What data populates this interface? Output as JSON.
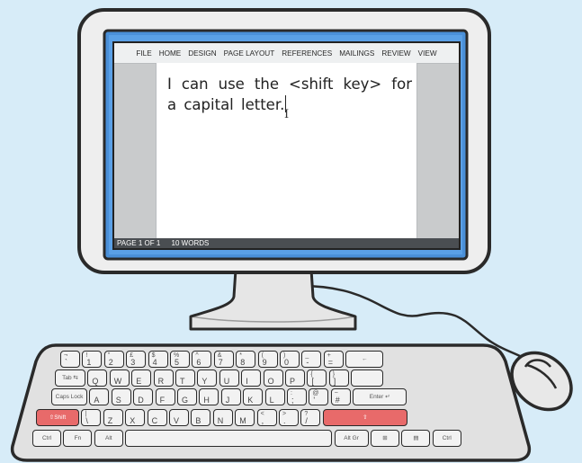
{
  "ribbon": {
    "tabs": [
      "FILE",
      "HOME",
      "DESIGN",
      "PAGE LAYOUT",
      "REFERENCES",
      "MAILINGS",
      "REVIEW",
      "VIEW"
    ]
  },
  "document": {
    "text": "I can use the <shift key> for a capital letter."
  },
  "status_bar": {
    "page": "PAGE 1 OF 1",
    "words": "10 WORDS"
  },
  "keyboard": {
    "rows": [
      [
        {
          "top": "¬",
          "bot": "`"
        },
        {
          "top": "!",
          "bot": "1"
        },
        {
          "top": "\"",
          "bot": "2"
        },
        {
          "top": "£",
          "bot": "3"
        },
        {
          "top": "$",
          "bot": "4"
        },
        {
          "top": "%",
          "bot": "5"
        },
        {
          "top": "^",
          "bot": "6"
        },
        {
          "top": "&",
          "bot": "7"
        },
        {
          "top": "*",
          "bot": "8"
        },
        {
          "top": "(",
          "bot": "9"
        },
        {
          "top": ")",
          "bot": "0"
        },
        {
          "top": "_",
          "bot": "-"
        },
        {
          "top": "+",
          "bot": "="
        },
        {
          "mid": "←"
        }
      ],
      [
        {
          "mid": "Tab ⇆"
        },
        {
          "bot": "Q"
        },
        {
          "bot": "W"
        },
        {
          "bot": "E"
        },
        {
          "bot": "R"
        },
        {
          "bot": "T"
        },
        {
          "bot": "Y"
        },
        {
          "bot": "U"
        },
        {
          "bot": "I"
        },
        {
          "bot": "O"
        },
        {
          "bot": "P"
        },
        {
          "top": "{",
          "bot": "["
        },
        {
          "top": "}",
          "bot": "]"
        },
        {
          "mid": ""
        }
      ],
      [
        {
          "mid": "Caps Lock"
        },
        {
          "bot": "A"
        },
        {
          "bot": "S"
        },
        {
          "bot": "D"
        },
        {
          "bot": "F"
        },
        {
          "bot": "G"
        },
        {
          "bot": "H"
        },
        {
          "bot": "J"
        },
        {
          "bot": "K"
        },
        {
          "bot": "L"
        },
        {
          "top": ":",
          "bot": ";"
        },
        {
          "top": "@",
          "bot": "'"
        },
        {
          "top": "~",
          "bot": "#"
        },
        {
          "mid": "Enter ↵"
        }
      ],
      [
        {
          "mid": "⇧Shift"
        },
        {
          "top": "|",
          "bot": "\\"
        },
        {
          "bot": "Z"
        },
        {
          "bot": "X"
        },
        {
          "bot": "C"
        },
        {
          "bot": "V"
        },
        {
          "bot": "B"
        },
        {
          "bot": "N"
        },
        {
          "bot": "M"
        },
        {
          "top": "<",
          "bot": ","
        },
        {
          "top": ">",
          "bot": "."
        },
        {
          "top": "?",
          "bot": "/"
        },
        {
          "mid": "⇧"
        }
      ],
      [
        {
          "mid": "Ctrl"
        },
        {
          "mid": "Fn"
        },
        {
          "mid": "Alt"
        },
        {
          "mid": ""
        },
        {
          "mid": "Alt Gr"
        },
        {
          "mid": "⊞"
        },
        {
          "mid": "▤"
        },
        {
          "mid": "Ctrl"
        }
      ]
    ],
    "highlighted_color": "#e86a6a"
  },
  "colors": {
    "background": "#d7ecf8",
    "monitor_frame": "#eeeeee",
    "screen_bezel": "#4a90d9",
    "keyboard_body": "#e1e1e1",
    "status_bar": "#4a4e52"
  }
}
